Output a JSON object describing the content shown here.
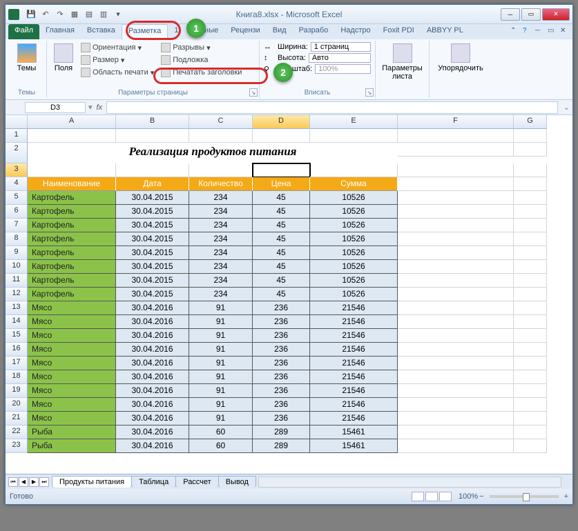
{
  "app": {
    "title": "Книга8.xlsx - Microsoft Excel"
  },
  "qat": [
    "💾",
    "↶",
    "↷",
    "▦",
    "▤",
    "▥",
    "▾"
  ],
  "tabs": {
    "file": "Файл",
    "list": [
      "Главная",
      "Вставка",
      "Разметка",
      "1",
      "Данные",
      "Рецензи",
      "Вид",
      "Разрабо",
      "Надстро",
      "Foxit PDI",
      "ABBYY PL"
    ],
    "active": 2
  },
  "callouts": {
    "c1": "1",
    "c2": "2"
  },
  "ribbon": {
    "themes": {
      "label": "Темы",
      "btn": "Темы"
    },
    "page": {
      "label": "Параметры страницы",
      "margins": "Поля",
      "orient": "Ориентация",
      "size": "Размер",
      "area": "Область печати",
      "breaks": "Разрывы",
      "bg": "Подложка",
      "titles": "Печатать заголовки"
    },
    "fit": {
      "label": "Вписать",
      "width": "Ширина:",
      "width_v": "1 страниц",
      "height": "Высота:",
      "height_v": "Авто",
      "scale": "Масштаб:",
      "scale_v": "100%"
    },
    "sheet": {
      "btn": "Параметры\nлиста"
    },
    "arrange": {
      "btn": "Упорядочить"
    }
  },
  "namebox": "D3",
  "fx": "fx",
  "columns": [
    "",
    "A",
    "B",
    "C",
    "D",
    "E",
    "F",
    "G"
  ],
  "sheet_title": "Реализация продуктов питания",
  "headers": [
    "Наименование",
    "Дата",
    "Количество",
    "Цена",
    "Сумма"
  ],
  "rows": [
    {
      "r": 5,
      "n": "Картофель",
      "d": "30.04.2015",
      "q": "234",
      "p": "45",
      "s": "10526"
    },
    {
      "r": 6,
      "n": "Картофель",
      "d": "30.04.2015",
      "q": "234",
      "p": "45",
      "s": "10526"
    },
    {
      "r": 7,
      "n": "Картофель",
      "d": "30.04.2015",
      "q": "234",
      "p": "45",
      "s": "10526"
    },
    {
      "r": 8,
      "n": "Картофель",
      "d": "30.04.2015",
      "q": "234",
      "p": "45",
      "s": "10526"
    },
    {
      "r": 9,
      "n": "Картофель",
      "d": "30.04.2015",
      "q": "234",
      "p": "45",
      "s": "10526"
    },
    {
      "r": 10,
      "n": "Картофель",
      "d": "30.04.2015",
      "q": "234",
      "p": "45",
      "s": "10526"
    },
    {
      "r": 11,
      "n": "Картофель",
      "d": "30.04.2015",
      "q": "234",
      "p": "45",
      "s": "10526"
    },
    {
      "r": 12,
      "n": "Картофель",
      "d": "30.04.2015",
      "q": "234",
      "p": "45",
      "s": "10526"
    },
    {
      "r": 13,
      "n": "Мясо",
      "d": "30.04.2016",
      "q": "91",
      "p": "236",
      "s": "21546"
    },
    {
      "r": 14,
      "n": "Мясо",
      "d": "30.04.2016",
      "q": "91",
      "p": "236",
      "s": "21546"
    },
    {
      "r": 15,
      "n": "Мясо",
      "d": "30.04.2016",
      "q": "91",
      "p": "236",
      "s": "21546"
    },
    {
      "r": 16,
      "n": "Мясо",
      "d": "30.04.2016",
      "q": "91",
      "p": "236",
      "s": "21546"
    },
    {
      "r": 17,
      "n": "Мясо",
      "d": "30.04.2016",
      "q": "91",
      "p": "236",
      "s": "21546"
    },
    {
      "r": 18,
      "n": "Мясо",
      "d": "30.04.2016",
      "q": "91",
      "p": "236",
      "s": "21546"
    },
    {
      "r": 19,
      "n": "Мясо",
      "d": "30.04.2016",
      "q": "91",
      "p": "236",
      "s": "21546"
    },
    {
      "r": 20,
      "n": "Мясо",
      "d": "30.04.2016",
      "q": "91",
      "p": "236",
      "s": "21546"
    },
    {
      "r": 21,
      "n": "Мясо",
      "d": "30.04.2016",
      "q": "91",
      "p": "236",
      "s": "21546"
    },
    {
      "r": 22,
      "n": "Рыба",
      "d": "30.04.2016",
      "q": "60",
      "p": "289",
      "s": "15461"
    },
    {
      "r": 23,
      "n": "Рыба",
      "d": "30.04.2016",
      "q": "60",
      "p": "289",
      "s": "15461"
    }
  ],
  "sheets": {
    "list": [
      "Продукты питания",
      "Таблица",
      "Рассчет",
      "Вывод"
    ],
    "active": 0
  },
  "status": {
    "ready": "Готово",
    "zoom": "100%",
    "minus": "−",
    "plus": "+"
  }
}
